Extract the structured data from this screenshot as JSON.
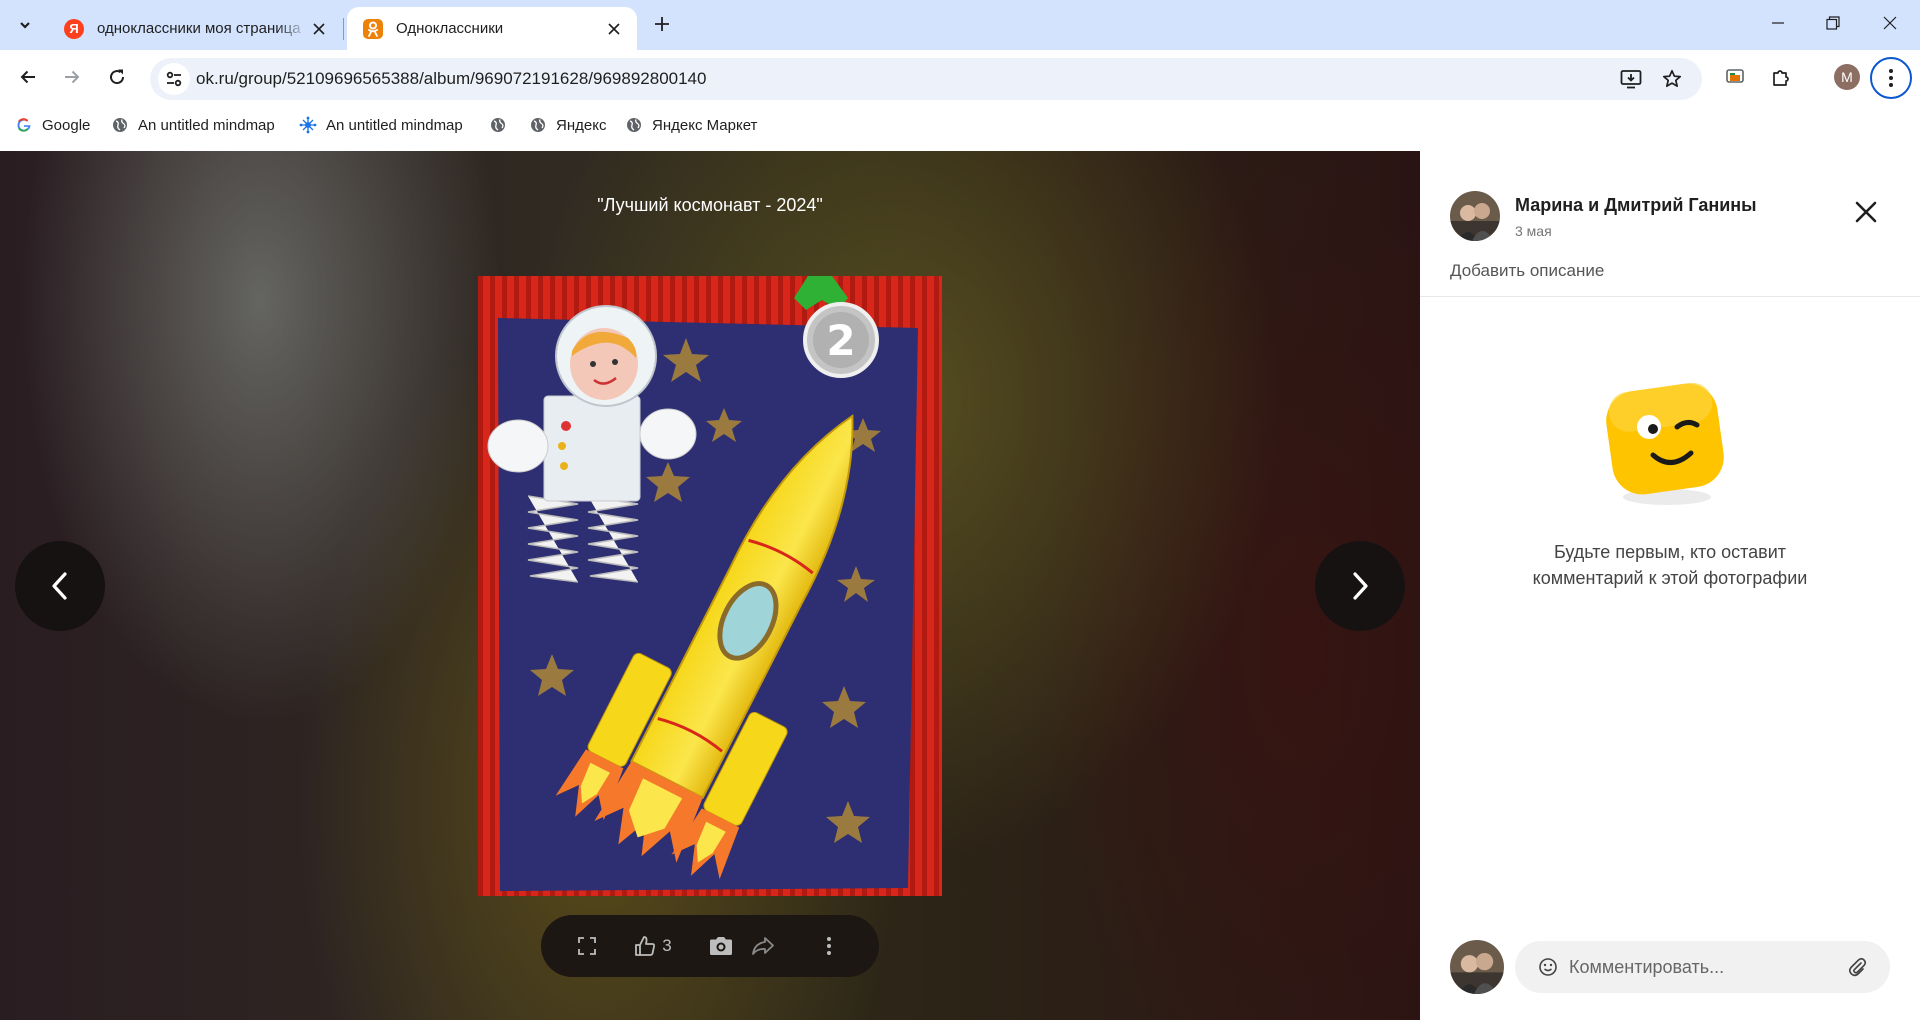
{
  "browser": {
    "tabs": [
      {
        "title": "одноклассники моя страница",
        "favicon": "yandex-favicon",
        "active": false
      },
      {
        "title": "Одноклассники",
        "favicon": "ok-favicon",
        "active": true
      }
    ],
    "url": "ok.ru/group/52109696565388/album/969072191628/969892800140",
    "profile_initial": "M",
    "bookmarks": [
      {
        "label": "Google",
        "icon": "google-icon"
      },
      {
        "label": "An untitled mindmap",
        "icon": "globe-icon"
      },
      {
        "label": "An untitled mindmap",
        "icon": "mindmap-icon"
      },
      {
        "label": "",
        "icon": "globe-icon"
      },
      {
        "label": "Яндекс",
        "icon": "globe-icon"
      },
      {
        "label": "Яндекс Маркет",
        "icon": "globe-icon"
      }
    ],
    "accent_color": "#d3e3fd"
  },
  "viewer": {
    "caption": "\"Лучший космонавт - 2024\"",
    "medal_number": "2",
    "likes_count": "3"
  },
  "side_panel": {
    "author_name": "Марина и Дмитрий Ганины",
    "date": "3 мая",
    "add_description": "Добавить описание",
    "empty_comments_line1": "Будьте первым, кто оставит",
    "empty_comments_line2": "комментарий к этой фотографии",
    "comment_placeholder": "Комментировать...",
    "mascot_color": "#ffc400"
  }
}
